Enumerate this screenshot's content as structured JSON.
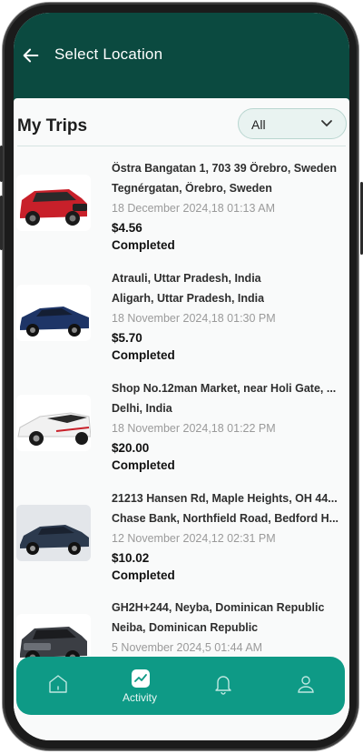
{
  "header": {
    "title": "Select Location"
  },
  "section": {
    "title": "My Trips",
    "filter_value": "All"
  },
  "trips": [
    {
      "from": "Östra Bangatan 1, 703 39 Örebro, Sweden",
      "to": "Tegnérgatan, Örebro, Sweden",
      "date": "18 December 2024,18 01:13 AM",
      "price": "$4.56",
      "status": "Completed",
      "car_color": "#c8202a"
    },
    {
      "from": "Atrauli, Uttar Pradesh, India",
      "to": "Aligarh, Uttar Pradesh, India",
      "date": "18 November 2024,18 01:30 PM",
      "price": "$5.70",
      "status": "Completed",
      "car_color": "#1e3567"
    },
    {
      "from": "Shop No.12man Market, near Holi Gate, ...",
      "to": "Delhi, India",
      "date": "18 November 2024,18 01:22 PM",
      "price": "$20.00",
      "status": "Completed",
      "car_color": "#f1f1f1"
    },
    {
      "from": "21213 Hansen Rd, Maple Heights, OH 44...",
      "to": "Chase Bank, Northfield Road, Bedford H...",
      "date": "12 November 2024,12 02:31 PM",
      "price": "$10.02",
      "status": "Completed",
      "car_color": "#2c3a4e"
    },
    {
      "from": "GH2H+244, Neyba, Dominican Republic",
      "to": "Neiba, Dominican Republic",
      "date": "5 November 2024,5 01:44 AM",
      "price": "",
      "status": "",
      "car_color": "#3b3e44"
    }
  ],
  "nav": {
    "active_label": "Activity",
    "items": [
      "home-icon",
      "activity-icon",
      "bell-icon",
      "profile-icon"
    ]
  },
  "colors": {
    "header": "#0b4a40",
    "nav": "#0e9a86"
  }
}
